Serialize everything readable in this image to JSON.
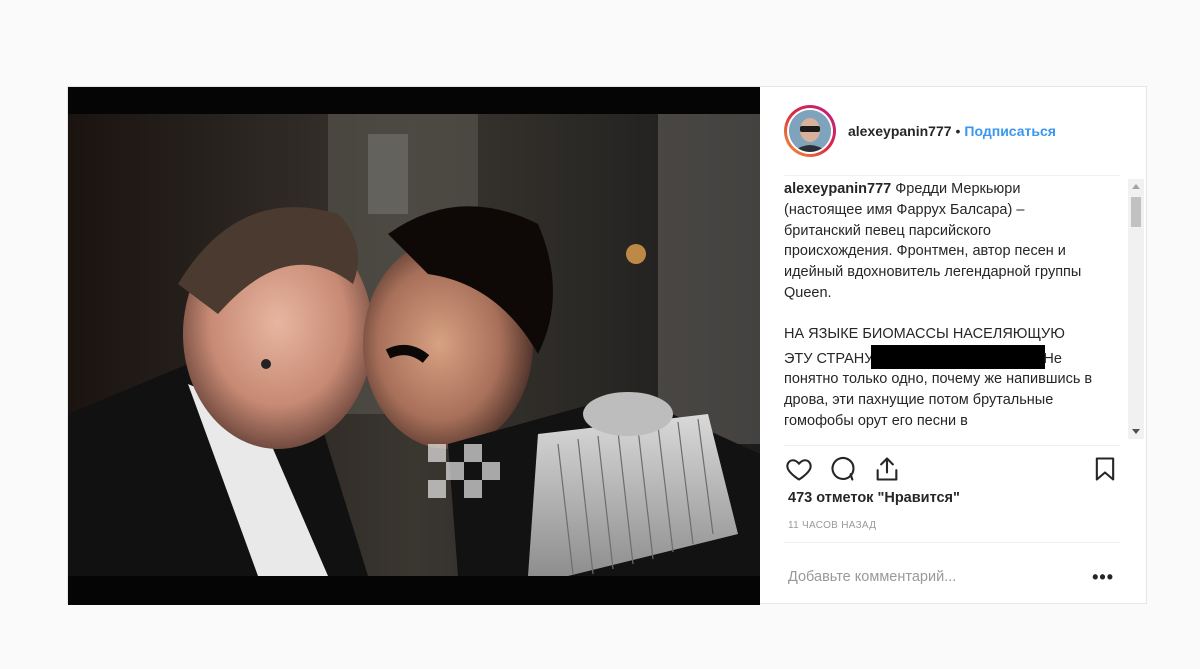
{
  "post": {
    "username": "alexeypanin777",
    "dot": "•",
    "follow_label": "Подписаться",
    "caption": {
      "username": "alexeypanin777",
      "para1": "Фредди Меркьюри (настоящее имя Фаррух Балсара) – британский певец парсийского происхождения. Фронтмен, автор песен и идейный вдохновитель легендарной группы Queen.",
      "para2_start": "НА ЯЗЫКЕ БИОМАССЫ НАСЕЛЯЮЩУЮ ЭТУ СТРАНУ",
      "para2_end": "Не понятно только одно, почему же напившись в дрова, эти пахнущие потом брутальные гомофобы орут его песни в"
    },
    "likes": "473 отметок \"Нравится\"",
    "time": "11 ЧАСОВ НАЗАД",
    "comment_placeholder": "Добавьте комментарий...",
    "more_label": "•••"
  },
  "icons": {
    "like": "heart-icon",
    "comment": "comment-icon",
    "share": "share-icon",
    "save": "bookmark-icon"
  }
}
